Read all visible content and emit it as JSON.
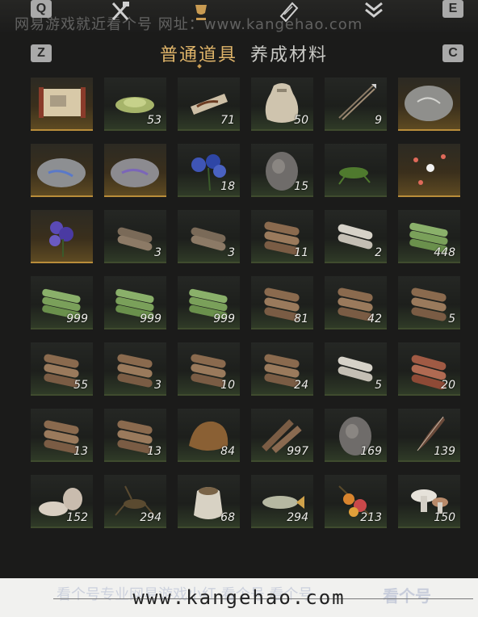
{
  "keys": {
    "prev_key": "Q",
    "next_key": "E",
    "sub_prev_key": "Z",
    "sub_next_key": "C"
  },
  "watermark_top": "网易游戏就近看个号   网址：www.kangehao.com",
  "tabs": [
    {
      "label": "普通道具",
      "active": true
    },
    {
      "label": "养成材料",
      "active": false
    }
  ],
  "top_icons": [
    "crossed-tools-icon",
    "trophy-icon",
    "scroll-icon",
    "rank-chevron-icon"
  ],
  "colors": {
    "accent": "#e0b56a",
    "count_text": "#eeeeea",
    "gold_cell": "#b98d3a"
  },
  "items": [
    {
      "icon": "map-scroll-icon",
      "count": "",
      "rarity": "gold"
    },
    {
      "icon": "green-powder-icon",
      "count": "53",
      "rarity": "normal"
    },
    {
      "icon": "worm-icon",
      "count": "71",
      "rarity": "normal"
    },
    {
      "icon": "cloth-sack-icon",
      "count": "50",
      "rarity": "normal"
    },
    {
      "icon": "arrows-icon",
      "count": "9",
      "rarity": "normal"
    },
    {
      "icon": "fossil-stone-icon",
      "count": "",
      "rarity": "gold"
    },
    {
      "icon": "blue-fossil-stone-icon",
      "count": "",
      "rarity": "gold"
    },
    {
      "icon": "purple-fossil-stone-icon",
      "count": "",
      "rarity": "gold"
    },
    {
      "icon": "blue-flower-icon",
      "count": "18",
      "rarity": "normal"
    },
    {
      "icon": "ore-rock-icon",
      "count": "15",
      "rarity": "normal"
    },
    {
      "icon": "grasshopper-icon",
      "count": "",
      "rarity": "normal"
    },
    {
      "icon": "fireflies-icon",
      "count": "",
      "rarity": "gold"
    },
    {
      "icon": "purple-flower-icon",
      "count": "",
      "rarity": "gold"
    },
    {
      "icon": "log-bundle-icon",
      "count": "3",
      "rarity": "normal"
    },
    {
      "icon": "log-bundle-icon",
      "count": "3",
      "rarity": "normal"
    },
    {
      "icon": "log-stack-icon",
      "count": "11",
      "rarity": "normal"
    },
    {
      "icon": "birch-logs-icon",
      "count": "2",
      "rarity": "normal"
    },
    {
      "icon": "bamboo-bundle-icon",
      "count": "448",
      "rarity": "normal"
    },
    {
      "icon": "bamboo-bundle-icon",
      "count": "999",
      "rarity": "normal"
    },
    {
      "icon": "bamboo-bundle-icon",
      "count": "999",
      "rarity": "normal"
    },
    {
      "icon": "bamboo-bundle-icon",
      "count": "999",
      "rarity": "normal"
    },
    {
      "icon": "log-stack-icon",
      "count": "81",
      "rarity": "normal"
    },
    {
      "icon": "log-stack-icon",
      "count": "42",
      "rarity": "normal"
    },
    {
      "icon": "log-stack-icon",
      "count": "5",
      "rarity": "normal"
    },
    {
      "icon": "log-stack-icon",
      "count": "55",
      "rarity": "normal"
    },
    {
      "icon": "log-stack-icon",
      "count": "3",
      "rarity": "normal"
    },
    {
      "icon": "log-stack-icon",
      "count": "10",
      "rarity": "normal"
    },
    {
      "icon": "log-stack-icon",
      "count": "24",
      "rarity": "normal"
    },
    {
      "icon": "birch-logs-icon",
      "count": "5",
      "rarity": "normal"
    },
    {
      "icon": "red-logs-icon",
      "count": "20",
      "rarity": "normal"
    },
    {
      "icon": "log-stack-icon",
      "count": "13",
      "rarity": "normal"
    },
    {
      "icon": "log-stack-icon",
      "count": "13",
      "rarity": "normal"
    },
    {
      "icon": "bark-pile-icon",
      "count": "84",
      "rarity": "normal"
    },
    {
      "icon": "firewood-icon",
      "count": "997",
      "rarity": "normal"
    },
    {
      "icon": "ore-rock-icon",
      "count": "169",
      "rarity": "normal"
    },
    {
      "icon": "feather-icon",
      "count": "139",
      "rarity": "normal"
    },
    {
      "icon": "shells-icon",
      "count": "152",
      "rarity": "normal"
    },
    {
      "icon": "cricket-icon",
      "count": "294",
      "rarity": "normal"
    },
    {
      "icon": "grain-sack-icon",
      "count": "68",
      "rarity": "normal"
    },
    {
      "icon": "fish-icon",
      "count": "294",
      "rarity": "normal"
    },
    {
      "icon": "fruit-branch-icon",
      "count": "213",
      "rarity": "normal"
    },
    {
      "icon": "mushrooms-icon",
      "count": "150",
      "rarity": "normal"
    }
  ],
  "footer": {
    "url": "www.kangehao.com",
    "faint_text": "看个号专业网易游戏小红    看个号  看个号",
    "logo_text": "看个号"
  }
}
